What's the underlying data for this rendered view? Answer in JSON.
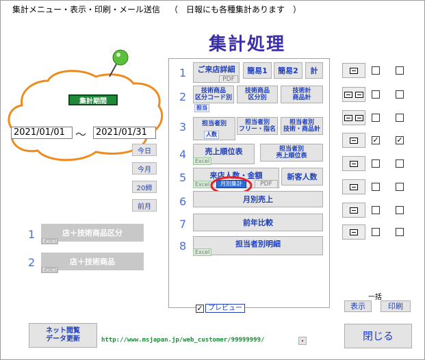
{
  "header": {
    "title": "集計メニュー・表示・印刷・メール送信",
    "note": "（　日報にも各種集計あります　）"
  },
  "main_title": "集計処理",
  "period": {
    "label": "集計期間",
    "from": "2021/01/01",
    "tilde": "〜",
    "to": "2021/01/31",
    "buttons": [
      "今日",
      "今月",
      "20締",
      "前月"
    ]
  },
  "rows": {
    "r1": {
      "num": "1",
      "btn_a": "ご来店詳細",
      "btn_a_tag": "PDF",
      "btn_b": "簡易1",
      "btn_c": "簡易2",
      "btn_d": "計"
    },
    "r2": {
      "num": "2",
      "btn_a1": "技術商品",
      "btn_a2": "区分コード別",
      "btn_a_sub": "担当",
      "btn_b1": "技術商品",
      "btn_b2": "区分別",
      "btn_c1": "技術計",
      "btn_c2": "商品計"
    },
    "r3": {
      "num": "3",
      "btn_a": "担当者別",
      "btn_a_sub": "人数",
      "btn_b1": "担当者別",
      "btn_b2": "フリー・指名",
      "btn_c1": "担当者別",
      "btn_c2": "技術・商品計"
    },
    "r4": {
      "num": "4",
      "btn_a": "売上順位表",
      "btn_a_tag": "Excel",
      "btn_b1": "担当者別",
      "btn_b2": "売上順位表"
    },
    "r5": {
      "num": "5",
      "btn_a": "来店人数・金額",
      "btn_a_tag": "Excel",
      "btn_a_tag2": "月別集計",
      "btn_a_tag3": "PDF",
      "btn_b": "新客人数"
    },
    "r6": {
      "num": "6",
      "btn": "月別売上"
    },
    "r7": {
      "num": "7",
      "btn": "前年比較"
    },
    "r8": {
      "num": "8",
      "btn": "担当者別明細",
      "tag": "Excel"
    }
  },
  "preview_label": "プレビュー",
  "left_items": [
    {
      "num": "1",
      "label": "店＋技術商品区分",
      "tag": "Excel"
    },
    {
      "num": "2",
      "label": "店＋技術商品",
      "tag": "Excel"
    }
  ],
  "bulk": {
    "label": "一括",
    "show": "表示",
    "print": "印刷"
  },
  "net_button": {
    "line1": "ネット閲覧",
    "line2": "データ更新"
  },
  "url": "http://www.msjapan.jp/web_customer/99999999/",
  "close_button": "閉じる",
  "checks": [
    {
      "a": false,
      "b": false
    },
    {
      "a": false,
      "b": false
    },
    {
      "a": false,
      "b": false
    },
    {
      "a": true,
      "b": true
    },
    {
      "a": false,
      "b": false
    },
    {
      "a": false,
      "b": false
    },
    {
      "a": false,
      "b": false
    },
    {
      "a": false,
      "b": false
    }
  ],
  "colors": {
    "accent": "#1f3fb8",
    "orange": "#f08a1c",
    "pin": "#5bbf3a",
    "highlight": "#e0222a"
  }
}
